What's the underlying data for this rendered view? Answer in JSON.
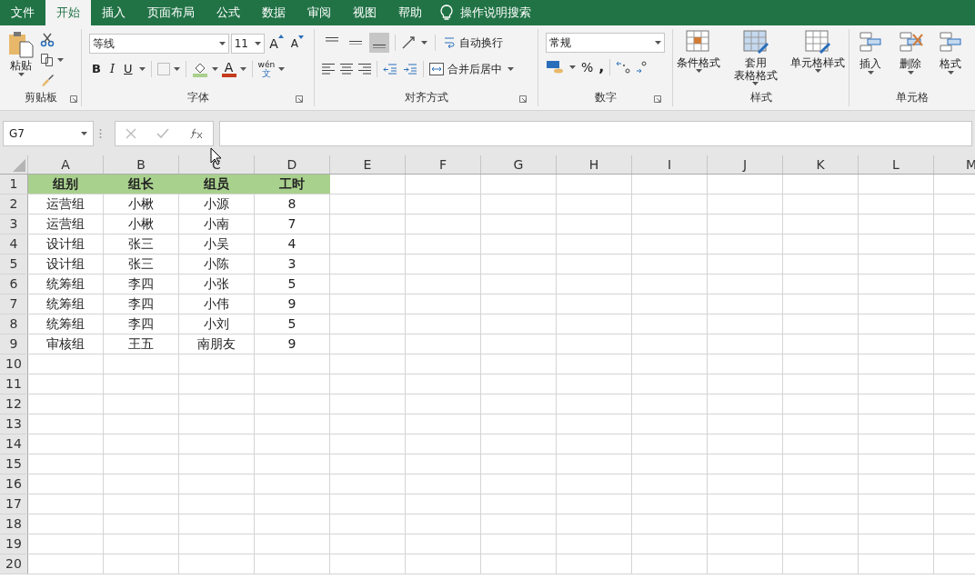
{
  "tabs": [
    {
      "label": "文件",
      "selected": false
    },
    {
      "label": "开始",
      "selected": true
    },
    {
      "label": "插入",
      "selected": false
    },
    {
      "label": "页面布局",
      "selected": false
    },
    {
      "label": "公式",
      "selected": false
    },
    {
      "label": "数据",
      "selected": false
    },
    {
      "label": "审阅",
      "selected": false
    },
    {
      "label": "视图",
      "selected": false
    },
    {
      "label": "帮助",
      "selected": false
    }
  ],
  "search": "操作说明搜索",
  "clipboard": {
    "label": "剪贴板",
    "paste": "粘贴"
  },
  "font": {
    "label": "字体",
    "font_name": "等线",
    "font_size": "11",
    "grow": "A",
    "shrink": "A",
    "bold": "B",
    "italic": "I",
    "underline": "U",
    "font_color": "A",
    "phonetic_top": "wén",
    "phonetic_bottom": "文"
  },
  "alignment": {
    "label": "对齐方式",
    "vertical": [
      {
        "selected": false
      },
      {
        "selected": false
      },
      {
        "selected": true
      }
    ],
    "wrap": "自动换行",
    "merge": "合并后居中"
  },
  "number": {
    "label": "数字",
    "format": "常规",
    "percent": "%",
    "comma": ","
  },
  "styles": {
    "label": "样式",
    "buttons": [
      {
        "lines": [
          "条件格式"
        ]
      },
      {
        "lines": [
          "套用",
          "表格格式"
        ]
      },
      {
        "lines": [
          "单元格样式"
        ]
      }
    ]
  },
  "cells_group": {
    "label": "单元格",
    "buttons": [
      "插入",
      "删除",
      "格式"
    ]
  },
  "name_box": "G7",
  "columns": [
    "A",
    "B",
    "C",
    "D",
    "E",
    "F",
    "G",
    "H",
    "I",
    "J",
    "K",
    "L",
    "M"
  ],
  "rows": [
    {
      "n": "1",
      "kind": "header",
      "cells": [
        "组别",
        "组长",
        "组员",
        "工时"
      ]
    },
    {
      "n": "2",
      "kind": "data",
      "cells": [
        "运营组",
        "小楸",
        "小源",
        "8"
      ]
    },
    {
      "n": "3",
      "kind": "data",
      "cells": [
        "运营组",
        "小楸",
        "小南",
        "7"
      ]
    },
    {
      "n": "4",
      "kind": "data",
      "cells": [
        "设计组",
        "张三",
        "小吴",
        "4"
      ]
    },
    {
      "n": "5",
      "kind": "data",
      "cells": [
        "设计组",
        "张三",
        "小陈",
        "3"
      ]
    },
    {
      "n": "6",
      "kind": "data",
      "cells": [
        "统筹组",
        "李四",
        "小张",
        "5"
      ]
    },
    {
      "n": "7",
      "kind": "data",
      "cells": [
        "统筹组",
        "李四",
        "小伟",
        "9"
      ]
    },
    {
      "n": "8",
      "kind": "data",
      "cells": [
        "统筹组",
        "李四",
        "小刘",
        "5"
      ]
    },
    {
      "n": "9",
      "kind": "data",
      "cells": [
        "审核组",
        "王五",
        "南朋友",
        "9"
      ]
    },
    {
      "n": "10",
      "kind": "data",
      "cells": []
    },
    {
      "n": "11",
      "kind": "data",
      "cells": []
    },
    {
      "n": "12",
      "kind": "data",
      "cells": []
    },
    {
      "n": "13",
      "kind": "data",
      "cells": []
    },
    {
      "n": "14",
      "kind": "data",
      "cells": []
    },
    {
      "n": "15",
      "kind": "data",
      "cells": []
    },
    {
      "n": "16",
      "kind": "data",
      "cells": []
    },
    {
      "n": "17",
      "kind": "data",
      "cells": []
    },
    {
      "n": "18",
      "kind": "data",
      "cells": []
    },
    {
      "n": "19",
      "kind": "data",
      "cells": []
    },
    {
      "n": "20",
      "kind": "data",
      "cells": []
    }
  ]
}
